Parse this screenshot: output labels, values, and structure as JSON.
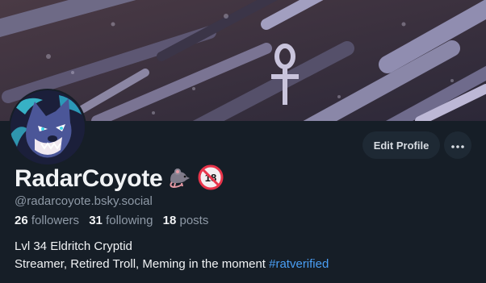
{
  "profile": {
    "display_name": "RadarCoyote",
    "handle": "@radarcoyote.bsky.social",
    "followers_count": "26",
    "followers_label": "followers",
    "following_count": "31",
    "following_label": "following",
    "posts_count": "18",
    "posts_label": "posts",
    "bio_line1": "Lvl 34 Eldritch Cryptid",
    "bio_line2_text": "Streamer, Retired Troll, Meming in the moment ",
    "bio_hashtag": "#ratverified",
    "name_emojis": [
      "rat-icon",
      "no-one-under-eighteen-icon"
    ],
    "no_under_18_text": "18"
  },
  "actions": {
    "edit_profile_label": "Edit Profile",
    "more_icon": "ellipsis-icon"
  },
  "colors": {
    "background": "#161e27",
    "button_bg": "#1e2934",
    "secondary_text": "#8e99a6",
    "link": "#4a9ff5"
  }
}
